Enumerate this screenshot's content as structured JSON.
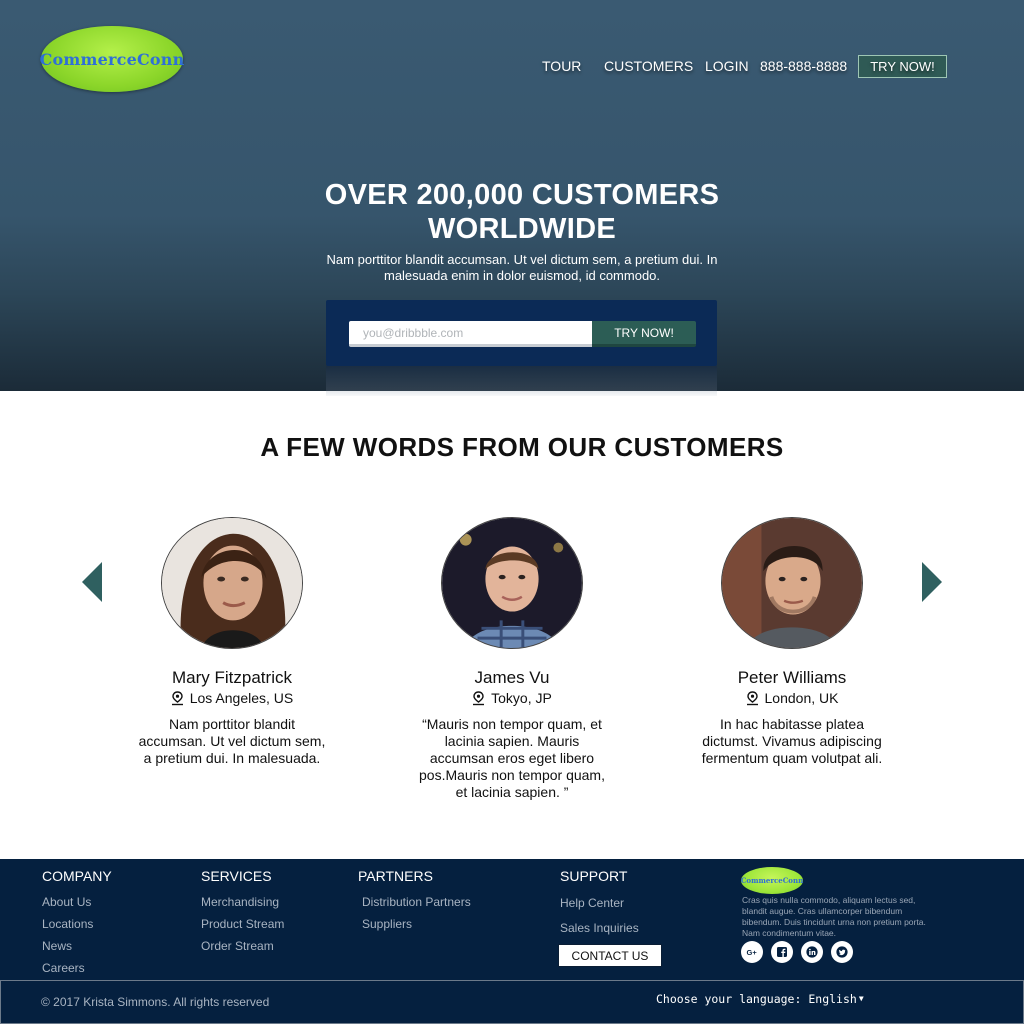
{
  "brand": {
    "name": "CommerceConn",
    "accent": "#8cd62a",
    "logo_text_color": "#2f6fd6"
  },
  "nav": {
    "tour": "TOUR",
    "customers": "CUSTOMERS",
    "login": "LOGIN",
    "phone": "888-888-8888",
    "cta": "TRY NOW!"
  },
  "hero": {
    "title": "OVER 200,000 CUSTOMERS WORLDWIDE",
    "subtitle": "Nam porttitor blandit accumsan. Ut vel dictum sem, a pretium dui. In malesuada enim in dolor euismod, id commodo.",
    "email_placeholder": "you@dribbble.com",
    "button": "TRY NOW!"
  },
  "testimonials": {
    "title": "A FEW WORDS FROM OUR CUSTOMERS",
    "items": [
      {
        "name": "Mary Fitzpatrick",
        "location": "Los Angeles, US",
        "quote": "Nam porttitor blandit accumsan. Ut vel dictum sem, a pretium dui. In malesuada."
      },
      {
        "name": "James Vu",
        "location": "Tokyo, JP",
        "quote": "“Mauris non tempor quam, et lacinia sapien. Mauris accumsan eros eget libero pos.Mauris non tempor quam, et lacinia sapien. ”"
      },
      {
        "name": "Peter Williams",
        "location": "London, UK",
        "quote": "In hac habitasse platea dictumst. Vivamus adipiscing fermentum quam volutpat ali."
      }
    ]
  },
  "footer": {
    "company": {
      "title": "COMPANY",
      "links": [
        "About Us",
        "Locations",
        "News",
        "Careers"
      ]
    },
    "services": {
      "title": "SERVICES",
      "links": [
        "Merchandising",
        "Product Stream",
        "Order Stream"
      ]
    },
    "partners": {
      "title": "PARTNERS",
      "links": [
        "Distribution Partners",
        "Suppliers"
      ]
    },
    "support": {
      "title": "SUPPORT",
      "links": [
        "Help Center",
        "Sales Inquiries"
      ],
      "contact_button": "CONTACT US"
    },
    "logo_text": "CommerceConn",
    "about": "Cras quis nulla commodo, aliquam lectus sed, blandit augue. Cras ullamcorper bibendum bibendum. Duis tincidunt urna non pretium porta. Nam condimentum vitae.",
    "social": [
      "google-plus-icon",
      "facebook-icon",
      "linkedin-icon",
      "twitter-icon"
    ],
    "copyright": "© 2017 Krista Simmons. All rights reserved",
    "language_label": "Choose your language:",
    "language_value": "English"
  }
}
